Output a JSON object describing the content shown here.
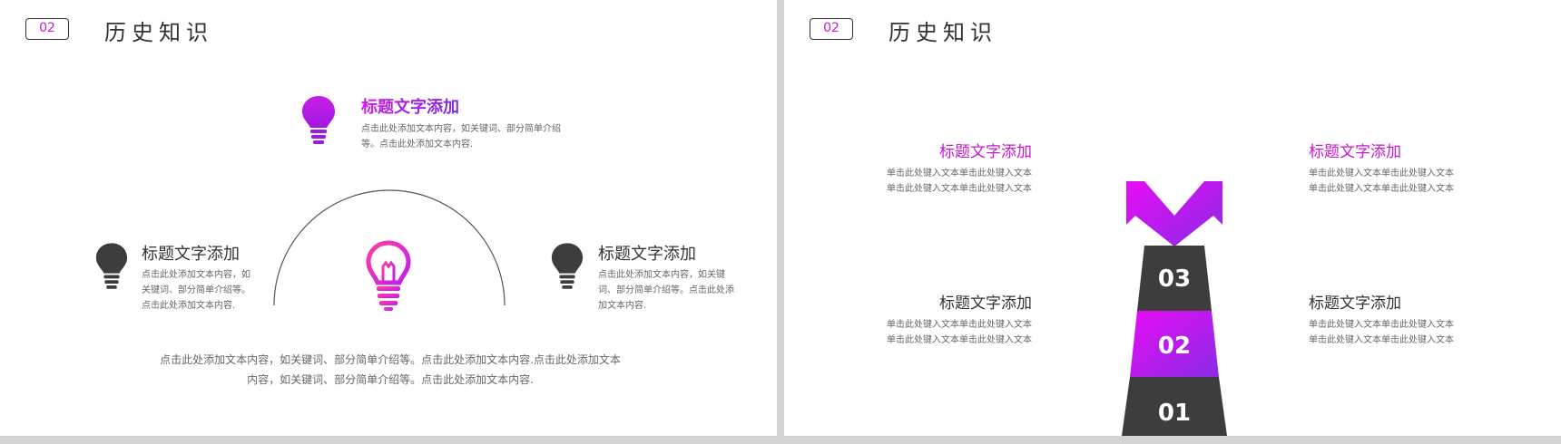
{
  "left": {
    "badge": "02",
    "title": "历史知识",
    "top_item": {
      "title": "标题文字添加",
      "desc": "点击此处添加文本内容，如关键词、部分简单介绍等。点击此处添加文本内容."
    },
    "left_item": {
      "title": "标题文字添加",
      "desc": "点击此处添加文本内容，如关键词、部分简单介绍等。点击此处添加文本内容."
    },
    "right_item": {
      "title": "标题文字添加",
      "desc": "点击此处添加文本内容，如关键词、部分简单介绍等。点击此处添加文本内容."
    },
    "bottom_text": "点击此处添加文本内容，如关键词、部分简单介绍等。点击此处添加文本内容.点击此处添加文本内容，如关键词、部分简单介绍等。点击此处添加文本内容."
  },
  "right": {
    "badge": "02",
    "title": "历史知识",
    "items": [
      {
        "title": "标题文字添加",
        "line1": "单击此处键入文本单击此处键入文本",
        "line2": "单击此处键入文本单击此处键入文本"
      },
      {
        "title": "标题文字添加",
        "line1": "单击此处键入文本单击此处键入文本",
        "line2": "单击此处键入文本单击此处键入文本"
      },
      {
        "title": "标题文字添加",
        "line1": "单击此处键入文本单击此处键入文本",
        "line2": "单击此处键入文本单击此处键入文本"
      },
      {
        "title": "标题文字添加",
        "line1": "单击此处键入文本单击此处键入文本",
        "line2": "单击此处键入文本单击此处键入文本"
      }
    ],
    "levels": [
      "03",
      "02",
      "01"
    ]
  },
  "icons": {
    "bulb": "lightbulb-icon",
    "arrows": "split-arrow-icon"
  },
  "colors": {
    "magenta": "#d315e8",
    "purple": "#7b2fe0",
    "dark": "#3d3d3d"
  }
}
